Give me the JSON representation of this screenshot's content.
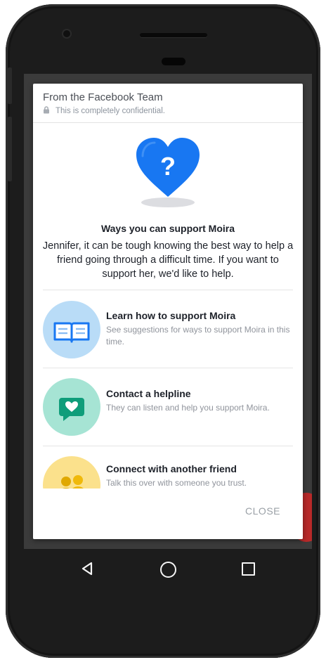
{
  "dialog": {
    "header": {
      "title": "From the Facebook Team",
      "subtitle": "This is completely confidential."
    },
    "intro": {
      "title": "Ways you can support Moira",
      "body": "Jennifer, it can be tough knowing the best way to help a friend going through a difficult time. If you want to support her, we'd like to help."
    },
    "options": [
      {
        "title": "Learn how to support Moira",
        "description": "See suggestions for ways to support Moira in this time.",
        "icon": "book-icon",
        "icon_bg": "#b9dcf7"
      },
      {
        "title": "Contact a helpline",
        "description": "They can listen and help you support Moira.",
        "icon": "chat-heart-icon",
        "icon_bg": "#a6e4d4"
      },
      {
        "title": "Connect with another friend",
        "description": "Talk this over with someone you trust.",
        "icon": "people-icon",
        "icon_bg": "#fbe18c"
      }
    ],
    "close_label": "CLOSE"
  },
  "colors": {
    "brand_blue": "#1877f2",
    "text_primary": "#1d2129",
    "text_secondary": "#90949c"
  }
}
